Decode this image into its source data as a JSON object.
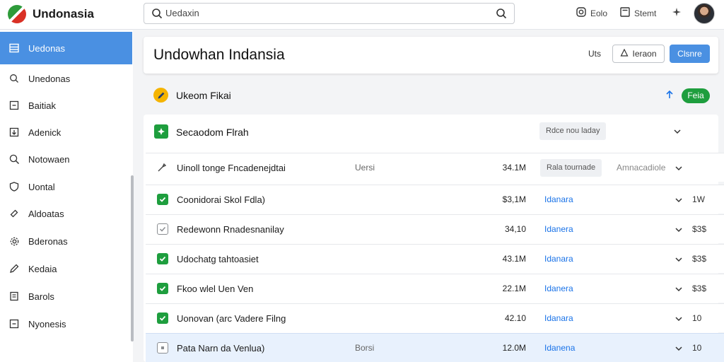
{
  "app": {
    "title": "Undonasia"
  },
  "search": {
    "value": "Uedaxin",
    "placeholder": "Uedaxin"
  },
  "top_actions": [
    {
      "label": "Eolo",
      "icon": "instagram-icon"
    },
    {
      "label": "Stemt",
      "icon": "window-icon"
    },
    {
      "label": "",
      "icon": "sparkle-icon"
    }
  ],
  "sidebar": {
    "items": [
      {
        "label": "Uedonas",
        "icon": "list-icon",
        "active": true
      },
      {
        "label": "Unedonas",
        "icon": "search-icon"
      },
      {
        "label": "Baitiak",
        "icon": "box-icon"
      },
      {
        "label": "Adenick",
        "icon": "download-box-icon"
      },
      {
        "label": "Notowaen",
        "icon": "magnifier-icon"
      },
      {
        "label": "Uontal",
        "icon": "shield-icon"
      },
      {
        "label": "Aldoatas",
        "icon": "link-icon"
      },
      {
        "label": "Bderonas",
        "icon": "gear-icon"
      },
      {
        "label": "Kedaia",
        "icon": "pencil-icon"
      },
      {
        "label": "Barols",
        "icon": "document-icon"
      },
      {
        "label": "Nyonesis",
        "icon": "box-icon"
      }
    ]
  },
  "header": {
    "title": "Undowhan Indansia",
    "link": "Uts",
    "outline_button": "Ieraon",
    "primary_button": "Clsnre"
  },
  "section": {
    "title": "Ukeom Fikai",
    "pill": "Feia"
  },
  "panel": {
    "title": "Secaodom Flrah",
    "chip": "Rdce nou laday",
    "rows": [
      {
        "name": "Uinoll tonge Fncadenejdtai",
        "mid": "Uersi",
        "size": "34.1M",
        "chip": "Rala tournade",
        "chip2": "Amnacadiole",
        "link": "",
        "val": "",
        "check": "none"
      },
      {
        "name": "Coonidorai Skol Fdla)",
        "mid": "",
        "size": "$3,1M",
        "link": "Idanara",
        "val": "1W",
        "check": "on"
      },
      {
        "name": "Redewonn Rnadesnanilay",
        "mid": "",
        "size": "34,10",
        "link": "Idanera",
        "val": "$3$",
        "check": "off"
      },
      {
        "name": "Udochatg tahtoasiet",
        "mid": "",
        "size": "43.1M",
        "link": "Idanara",
        "val": "$3$",
        "check": "on"
      },
      {
        "name": "Fkoo wlel Uen Ven",
        "mid": "",
        "size": "22.1M",
        "link": "Idanera",
        "val": "$3$",
        "check": "on"
      },
      {
        "name": "Uonovan (arc Vadere Filng",
        "mid": "",
        "size": "42.10",
        "link": "Idanara",
        "val": "10",
        "check": "on"
      },
      {
        "name": "Pata Narn da Venlua)",
        "mid": "Borsi",
        "size": "12.0M",
        "link": "Idanena",
        "val": "10",
        "check": "off"
      }
    ]
  },
  "colors": {
    "accent": "#4a90e2",
    "success": "#1e9e3e",
    "link": "#1a73e8"
  }
}
